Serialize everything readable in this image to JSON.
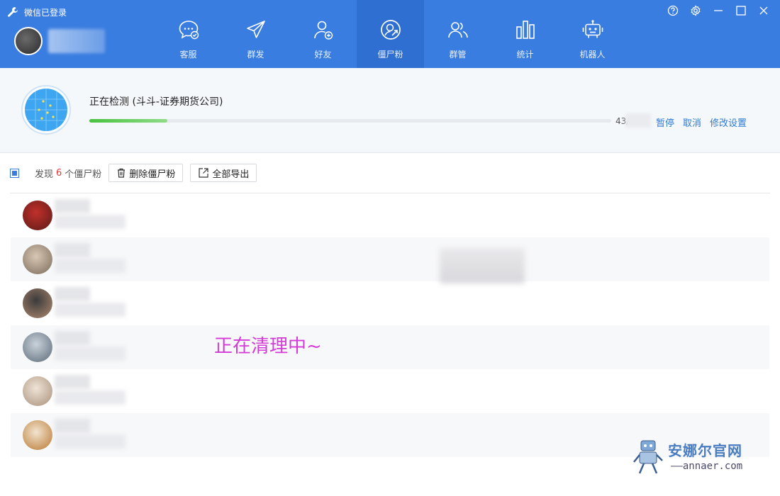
{
  "window": {
    "title": "微信已登录",
    "controls": [
      "help-icon",
      "gear-icon",
      "minimize-icon",
      "maximize-icon",
      "close-icon"
    ]
  },
  "nav": {
    "items": [
      {
        "label": "客服",
        "icon": "chat-check-icon",
        "active": false
      },
      {
        "label": "群发",
        "icon": "paper-plane-icon",
        "active": false
      },
      {
        "label": "好友",
        "icon": "add-friend-icon",
        "active": false
      },
      {
        "label": "僵尸粉",
        "icon": "zombie-fan-icon",
        "active": true
      },
      {
        "label": "群管",
        "icon": "group-icon",
        "active": false
      },
      {
        "label": "统计",
        "icon": "bar-stats-icon",
        "active": false
      },
      {
        "label": "机器人",
        "icon": "robot-icon",
        "active": false
      }
    ]
  },
  "progress": {
    "title": "正在检测 (斗斗-证券期货公司)",
    "fraction": 0.15,
    "count_text": "43/",
    "actions": {
      "pause": "暂停",
      "cancel": "取消",
      "settings": "修改设置"
    }
  },
  "toolbar": {
    "found_prefix": "发现",
    "found_count": "6",
    "found_suffix": "个僵尸粉",
    "delete_label": "删除僵尸粉",
    "export_label": "全部导出"
  },
  "list": {
    "rows": [
      {
        "avatar_colors": [
          "#c0302a",
          "#5a1a18"
        ]
      },
      {
        "avatar_colors": [
          "#d8c7b3",
          "#7a6a5a"
        ]
      },
      {
        "avatar_colors": [
          "#3b3b3b",
          "#b08a70"
        ]
      },
      {
        "avatar_colors": [
          "#c9d2da",
          "#5a6a78"
        ]
      },
      {
        "avatar_colors": [
          "#efe3d6",
          "#a88f7a"
        ]
      },
      {
        "avatar_colors": [
          "#f1e4cf",
          "#b9772f"
        ]
      }
    ]
  },
  "overlay": {
    "text": "正在清理中~"
  },
  "watermark": {
    "cn": "安娜尔官网",
    "en": "——annaer.com"
  },
  "colors": {
    "header": "#3a7de0",
    "active_tab": "#2f6fd1",
    "link": "#2e7ad6",
    "overlay": "#d33ad6",
    "count": "#e03c3c"
  }
}
